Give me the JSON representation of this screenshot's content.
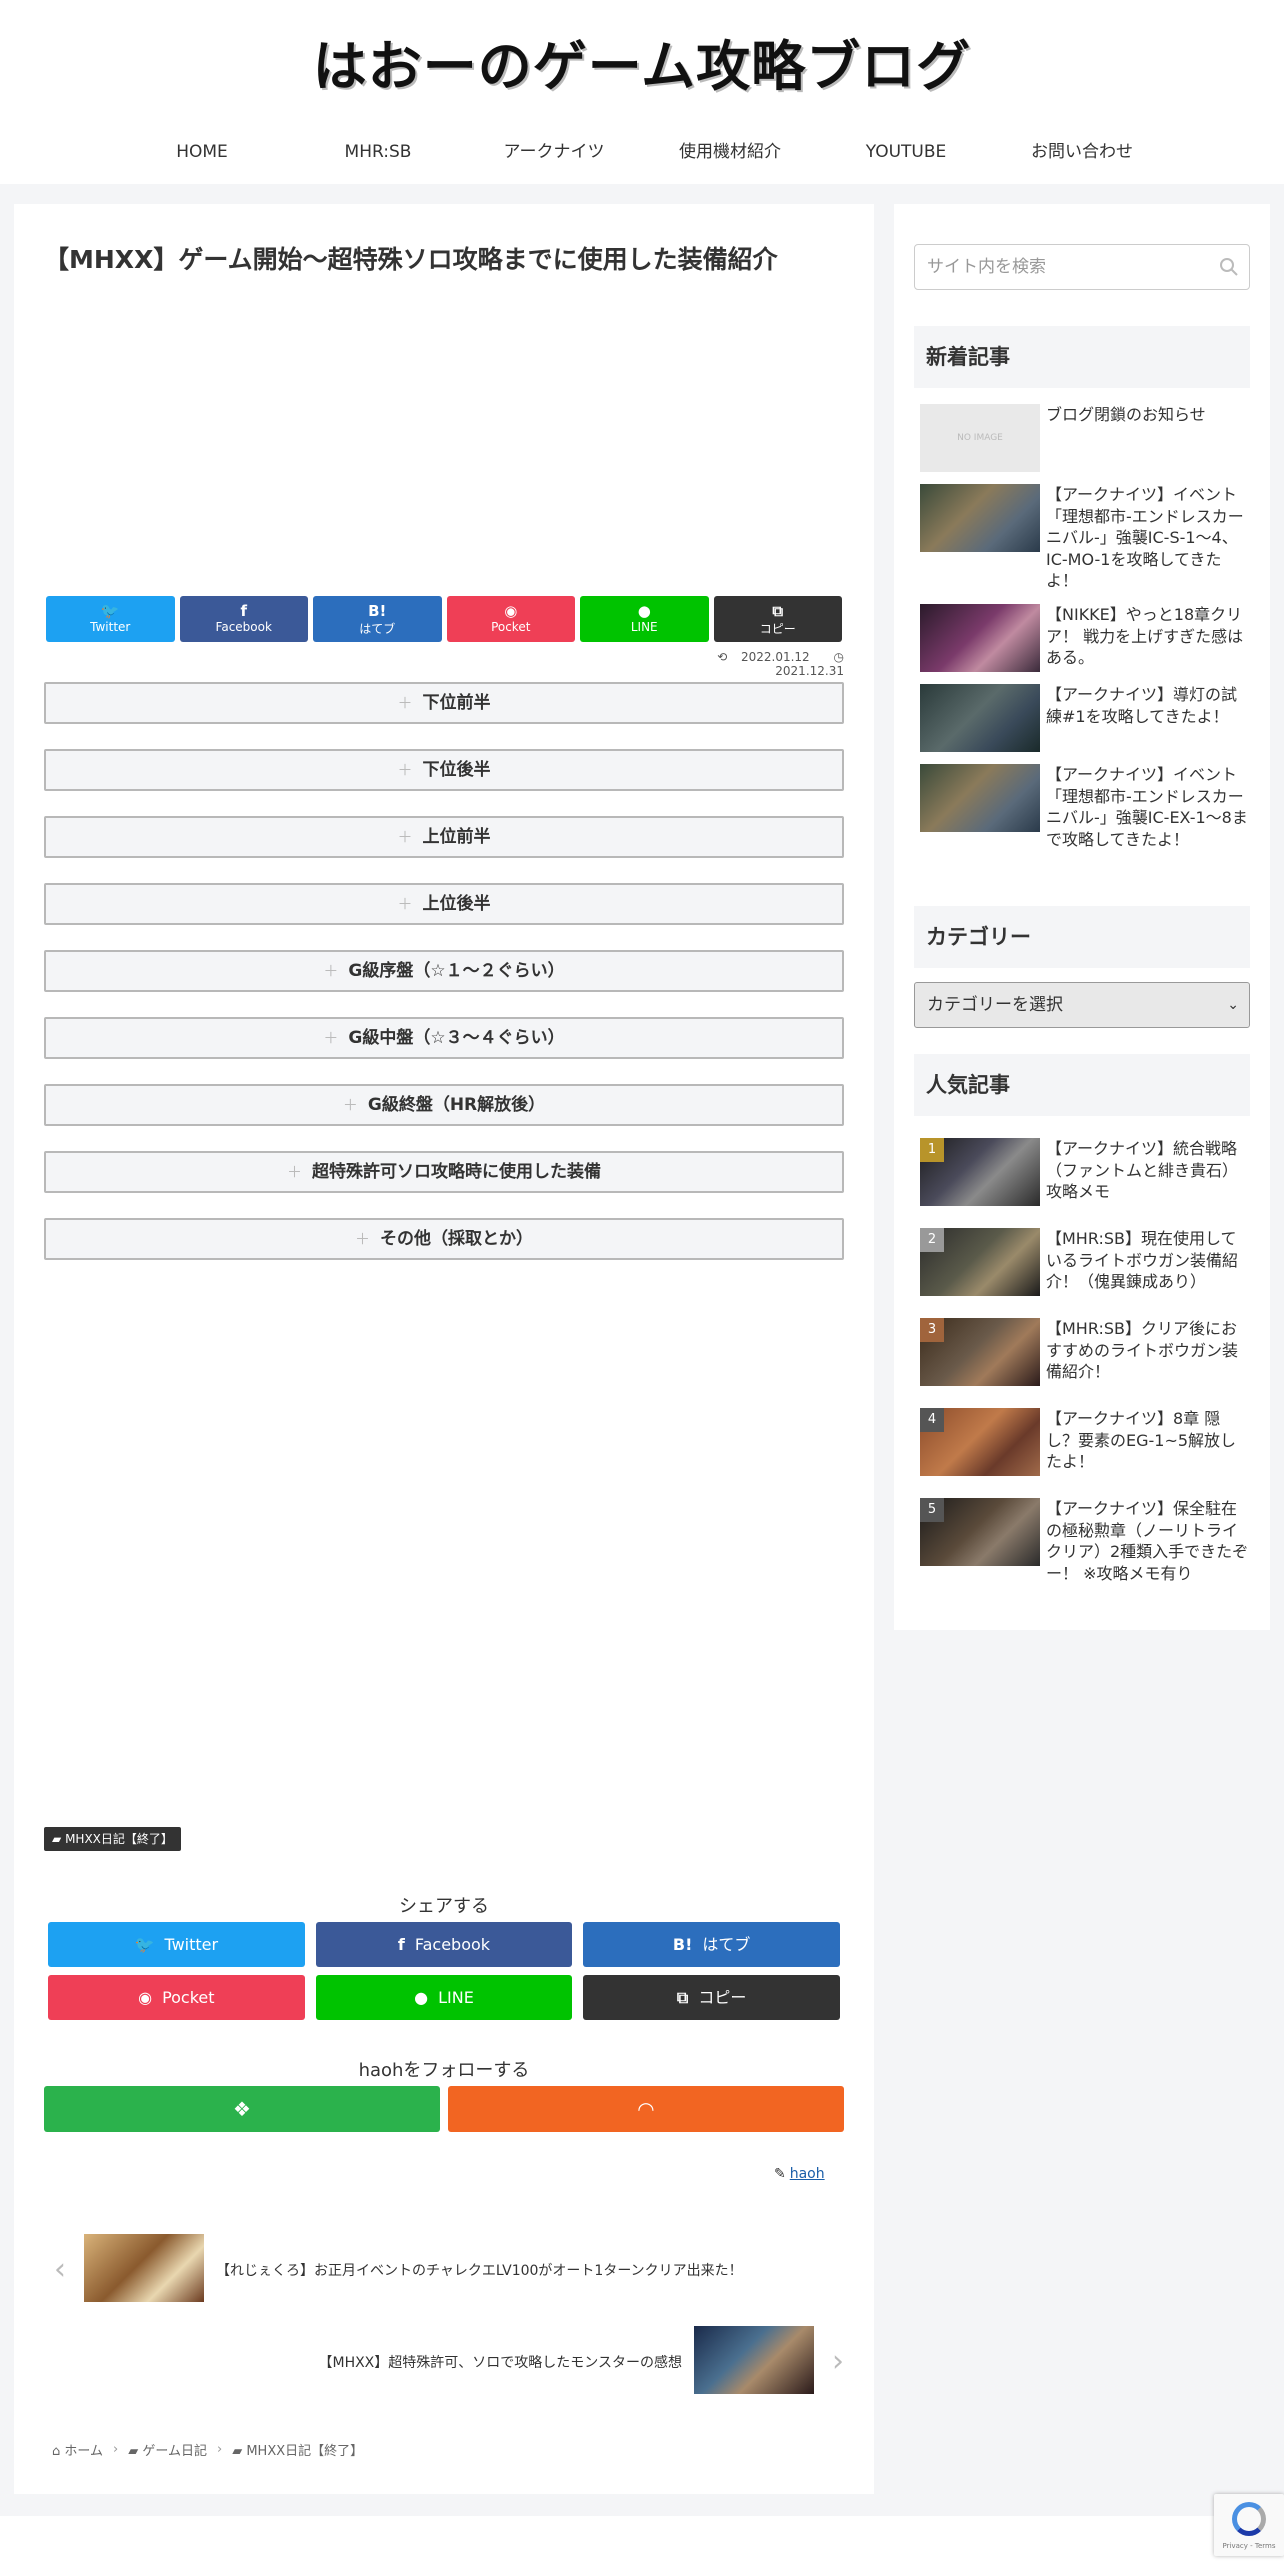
{
  "site": {
    "title": "はおーのゲーム攻略ブログ",
    "nav": [
      "HOME",
      "MHR:SB",
      "アークナイツ",
      "使用機材紹介",
      "YOUTUBE",
      "お問い合わせ"
    ]
  },
  "post": {
    "title": "【MHXX】ゲーム開始～超特殊ソロ攻略までに使用した装備紹介",
    "share_top": [
      {
        "icon": "twitter-icon",
        "glyph": "🐦",
        "label": "Twitter"
      },
      {
        "icon": "facebook-icon",
        "glyph": "f",
        "label": "Facebook"
      },
      {
        "icon": "hatena-icon",
        "glyph": "B!",
        "label": "はてブ"
      },
      {
        "icon": "pocket-icon",
        "glyph": "◉",
        "label": "Pocket"
      },
      {
        "icon": "line-icon",
        "glyph": "●",
        "label": "LINE"
      },
      {
        "icon": "copy-icon",
        "glyph": "⧉",
        "label": "コピー"
      }
    ],
    "updated": "2022.01.12",
    "published": "2021.12.31",
    "tabs": [
      "下位前半",
      "下位後半",
      "上位前半",
      "上位後半",
      "G級序盤（☆１～２ぐらい）",
      "G級中盤（☆３～４ぐらい）",
      "G級終盤（HR解放後）",
      "超特殊許可ソロ攻略時に使用した装備",
      "その他（採取とか）"
    ],
    "category_tag": "MHXX日記【終了】",
    "share_label": "シェアする",
    "share_bottom": [
      {
        "glyph": "🐦",
        "label": "Twitter"
      },
      {
        "glyph": "f",
        "label": "Facebook"
      },
      {
        "glyph": "B!",
        "label": "はてブ"
      },
      {
        "glyph": "◉",
        "label": "Pocket"
      },
      {
        "glyph": "●",
        "label": "LINE"
      },
      {
        "glyph": "⧉",
        "label": "コピー"
      }
    ],
    "follow_label": "haohをフォローする",
    "author": "haoh",
    "prev_title": "【れじぇくろ】お正月イベントのチャレクエLV100がオート1ターンクリア出来た！",
    "next_title": "【MHXX】超特殊許可、ソロで攻略したモンスターの感想",
    "breadcrumb": [
      "ホーム",
      "ゲーム日記",
      "MHXX日記【終了】"
    ]
  },
  "sidebar": {
    "search_placeholder": "サイト内を検索",
    "new_title": "新着記事",
    "new_articles": [
      "ブログ閉鎖のお知らせ",
      "【アークナイツ】イベント「理想都市-エンドレスカーニバル-」強襲IC-S-1～4、IC-MO-1を攻略してきたよ！",
      "【NIKKE】やっと18章クリア！ 戦力を上げすぎた感はある。",
      "【アークナイツ】導灯の試練#1を攻略してきたよ！",
      "【アークナイツ】イベント「理想都市-エンドレスカーニバル-」強襲IC-EX-1～8まで攻略してきたよ！"
    ],
    "category_title": "カテゴリー",
    "category_select": "カテゴリーを選択",
    "popular_title": "人気記事",
    "popular": [
      {
        "rank": "1",
        "title": "【アークナイツ】統合戦略（ファントムと緋き貴石）攻略メモ"
      },
      {
        "rank": "2",
        "title": "【MHR:SB】現在使用しているライトボウガン装備紹介！（傀異錬成あり）"
      },
      {
        "rank": "3",
        "title": "【MHR:SB】クリア後におすすめのライトボウガン装備紹介！"
      },
      {
        "rank": "4",
        "title": "【アークナイツ】8章 隠し？要素のEG-1~5解放したよ！"
      },
      {
        "rank": "5",
        "title": "【アークナイツ】保全駐在の極秘勲章（ノーリトライクリア）2種類入手できたぞー！ ※攻略メモ有り"
      }
    ],
    "no_image_text": "NO IMAGE"
  },
  "colors": {
    "twitter": "#1da1f2",
    "facebook": "#3b5998",
    "hatena": "#2c6ebd",
    "pocket": "#ef3f56",
    "line": "#00c300",
    "copy": "#333333",
    "feedly": "#2bb24c",
    "rss": "#f26522",
    "rank1": "#b8942a",
    "rank2": "#999999",
    "rank3": "#a0643c",
    "rank_other": "#555555"
  }
}
